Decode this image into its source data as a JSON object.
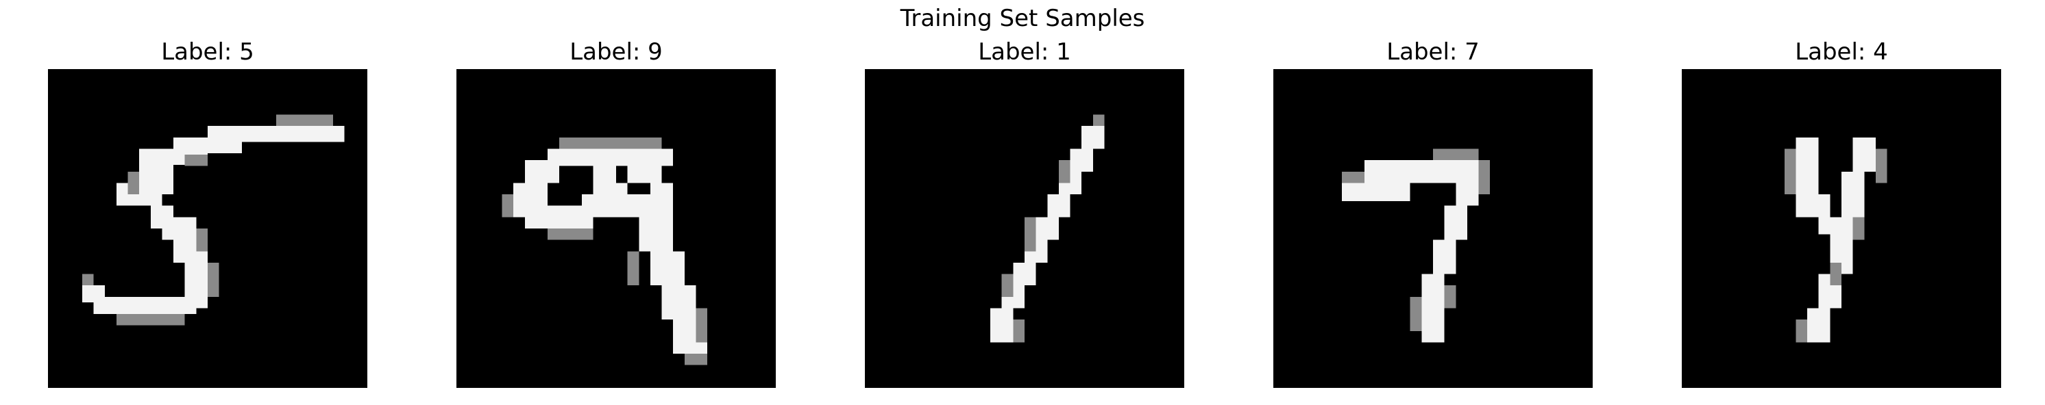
{
  "figure": {
    "title": "Training Set Samples"
  },
  "samples": [
    {
      "label_text": "Label: 5",
      "label": 5,
      "image_description": "handwritten digit five"
    },
    {
      "label_text": "Label: 9",
      "label": 9,
      "image_description": "handwritten digit nine"
    },
    {
      "label_text": "Label: 1",
      "label": 1,
      "image_description": "handwritten digit one"
    },
    {
      "label_text": "Label: 7",
      "label": 7,
      "image_description": "handwritten digit seven"
    },
    {
      "label_text": "Label: 4",
      "label": 4,
      "image_description": "handwritten digit four"
    }
  ]
}
